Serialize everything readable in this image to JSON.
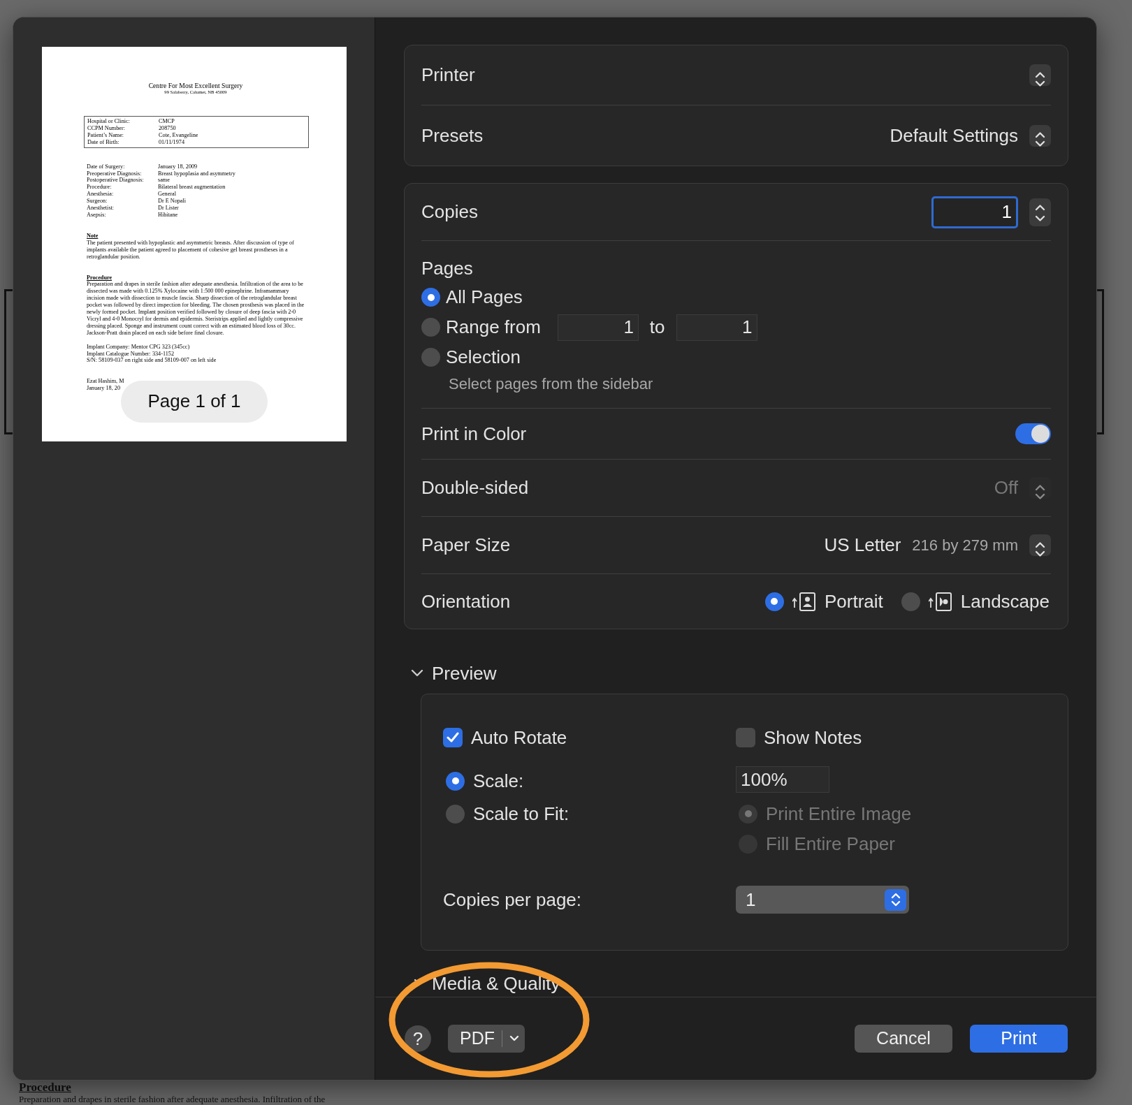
{
  "document_preview": {
    "title": "Centre For Most Excellent Surgery",
    "address": "99 Salaberry, Calumet, NB 45009",
    "patient_info": [
      {
        "label": "Hospital or Clinic:",
        "value": "CMCP"
      },
      {
        "label": "CCPM Number:",
        "value": "208750"
      },
      {
        "label": "Patient’s Name:",
        "value": "Cote, Evangeline"
      },
      {
        "label": "Date of Birth:",
        "value": "01/11/1974"
      }
    ],
    "surgery_details": [
      {
        "label": "Date of Surgery:",
        "value": "January 18, 2009"
      },
      {
        "label": "Preoperative Diagnosis:",
        "value": "Breast hypoplasia and asymmetry"
      },
      {
        "label": "Postoperative Diagnosis:",
        "value": "same"
      },
      {
        "label": "Procedure:",
        "value": "Bilateral breast augmentation"
      },
      {
        "label": "Anesthesia:",
        "value": "General"
      },
      {
        "label": "Surgeon:",
        "value": "Dr E Nopali"
      },
      {
        "label": "Anesthetist:",
        "value": "Dr Lister"
      },
      {
        "label": "Asepsis:",
        "value": "Hibitane"
      }
    ],
    "sections": [
      {
        "heading": "Note",
        "paragraph": "The patient presented with hypoplastic and asymmetric breasts. After discussion of type of implants available the patient agreed to placement of cohesive gel breast prostheses in a retroglandular position."
      },
      {
        "heading": "Procedure",
        "paragraph": "Preparation and drapes in sterile fashion after adequate anesthesia. Infiltration of the area to be dissected was made with 0.125% Xylocaine with 1:500 000 epinephrine. Inframammary incision made with dissection to muscle fascia. Sharp dissection of the retroglandular breast pocket was followed by direct inspection for bleeding. The chosen prosthesis was placed in the newly formed pocket. Implant position verified followed by closure of deep fascia with 2-0 Vicryl and 4-0 Monocryl for dermis and epidermis. Steristrips applied and lightly compressive dressing placed. Sponge and instrument count correct with an estimated blood loss of 30cc. Jackson-Pratt drain placed on each side before final closure.",
        "lines": [
          "Implant Company: Mentor CPG 323 (345cc)",
          "Implant Catalogue Number: 334-1152",
          "S/N: 58109-037 on right side and 58109-007 on left side"
        ]
      }
    ],
    "signature": [
      "Ezat Hashim, M",
      "January 18, 20"
    ],
    "page_label": "Page 1 of 1"
  },
  "printer": {
    "label": "Printer"
  },
  "presets": {
    "label": "Presets",
    "value": "Default Settings"
  },
  "copies": {
    "label": "Copies",
    "value": "1"
  },
  "pages": {
    "label": "Pages",
    "options": [
      {
        "kind": "plain",
        "label": "All Pages",
        "selected": true
      },
      {
        "kind": "range",
        "label": "Range from",
        "selected": false,
        "from": "1",
        "to_label": "to",
        "to": "1"
      },
      {
        "kind": "hint",
        "label": "Selection",
        "selected": false,
        "hint": "Select pages from the sidebar"
      }
    ]
  },
  "print_in_color": {
    "label": "Print in Color",
    "on": true
  },
  "double_sided": {
    "label": "Double-sided",
    "value": "Off",
    "disabled": true
  },
  "paper_size": {
    "label": "Paper Size",
    "value": "US Letter",
    "detail": "216 by 279 mm"
  },
  "orientation": {
    "label": "Orientation",
    "options": [
      {
        "kind": "portrait",
        "label": "Portrait",
        "selected": true
      },
      {
        "kind": "landscape",
        "label": "Landscape",
        "selected": false
      }
    ]
  },
  "preview": {
    "title": "Preview",
    "expanded": true,
    "auto_rotate": {
      "label": "Auto Rotate",
      "checked": true
    },
    "show_notes": {
      "label": "Show Notes",
      "checked": false
    },
    "scale_options": [
      {
        "label": "Scale:",
        "selected": true
      },
      {
        "label": "Scale to Fit:",
        "selected": false
      }
    ],
    "scale_value": "100%",
    "fit_options": [
      {
        "label": "Print Entire Image",
        "selected": true,
        "disabled": true
      },
      {
        "label": "Fill Entire Paper",
        "selected": false,
        "disabled": true
      }
    ],
    "copies_per_page": {
      "label": "Copies per page:",
      "value": "1"
    }
  },
  "media_quality": {
    "title": "Media & Quality",
    "expanded": false
  },
  "footer": {
    "help": "?",
    "pdf": "PDF",
    "cancel": "Cancel",
    "print": "Print"
  },
  "background_document": {
    "heading": "Procedure",
    "line": "Preparation and drapes in sterile fashion after adequate anesthesia. Infiltration of the"
  }
}
